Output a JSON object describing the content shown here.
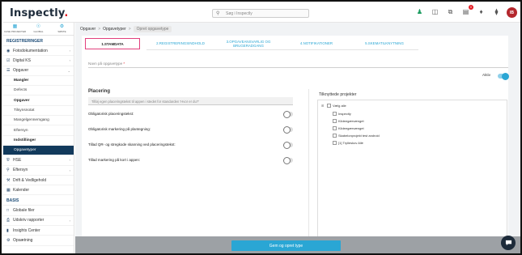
{
  "brand": {
    "logo_text": "Inspectly",
    "logo_dot": ".",
    "accent": "#2aa6d4",
    "dark": "#123a5c",
    "red": "#e31b23"
  },
  "header": {
    "search_placeholder": "Søg i Inspectly",
    "icons": [
      "person-upload-icon",
      "sitemap-icon",
      "copy-icon",
      "notification-cart-icon",
      "bell-icon",
      "pin-icon"
    ],
    "notification_count": "0",
    "avatar_initials": "IB"
  },
  "sidebar": {
    "top_nav": [
      {
        "label": "CASE PROJEKTER",
        "icon": "case-icon"
      },
      {
        "label": "GLOBAL",
        "icon": "globe-icon"
      },
      {
        "label": "SØNTE",
        "icon": "settings-icon"
      }
    ],
    "section_registreringer": "REGISTRERINGER",
    "items_a": [
      {
        "label": "Fotodokumentation",
        "icon": "camera-icon",
        "has_chevron": true
      },
      {
        "label": "Digital KS",
        "icon": "checklist-icon",
        "has_chevron": true
      },
      {
        "label": "Opgaver",
        "icon": "task-icon",
        "has_chevron": true
      }
    ],
    "opgaver_sub": [
      {
        "label": "Mangler",
        "style": "bold"
      },
      {
        "label": "Defects",
        "style": ""
      },
      {
        "label": "Opgaver",
        "style": "bold"
      },
      {
        "label": "Tilsynsnotat",
        "style": ""
      },
      {
        "label": "Mangelgennemgang",
        "style": ""
      },
      {
        "label": "Eftersyn",
        "style": ""
      },
      {
        "label": "Indstillinger",
        "style": "bold"
      },
      {
        "label": "Opgavetyper",
        "style": "active"
      }
    ],
    "items_b": [
      {
        "label": "HSE",
        "icon": "shield-icon",
        "has_chevron": true
      },
      {
        "label": "Eftersyn",
        "icon": "search-icon",
        "has_chevron": true
      },
      {
        "label": "Drift & Vedligehold",
        "icon": "wrench-icon",
        "has_chevron": false
      },
      {
        "label": "Kalender",
        "icon": "calendar-icon",
        "has_chevron": false
      }
    ],
    "section_basis": "BASIS",
    "items_c": [
      {
        "label": "Globale filer",
        "icon": "file-icon",
        "has_chevron": false
      },
      {
        "label": "Udskriv rapporter",
        "icon": "print-icon",
        "has_chevron": true
      },
      {
        "label": "Insights Center",
        "icon": "chart-icon",
        "has_chevron": false
      },
      {
        "label": "Opsætning",
        "icon": "gear-icon",
        "has_chevron": false
      }
    ]
  },
  "breadcrumb": {
    "items": [
      "Opgaver",
      "Opgavetyper"
    ],
    "current": "Opret opgavetype",
    "separator": ">"
  },
  "tabs": [
    "1.STAMDATA",
    "2.REGISTRERINGSINDHOLD",
    "3.OPGAVEANSVARLIG OG BRUGERADGANG",
    "4.NOTIFIKATIONER",
    "5.SKEMATILKNYTNING"
  ],
  "form": {
    "name_label": "Navn på opgavetype",
    "required_mark": "*",
    "aktiv_label": "Aktiv",
    "aktiv_on": true,
    "placering_title": "Placering",
    "placering_placeholder": "Tilføj egen placeringstekst til appen i stedet for standarden 'Hvor er du?'",
    "toggles": [
      {
        "label": "Obligatorisk placeringstekst:",
        "on": false
      },
      {
        "label": "Obligatorisk markering på plantegning:",
        "on": false
      },
      {
        "label": "Tillad QR- og stregkode skanning ved placeringstekst:",
        "on": false
      },
      {
        "label": "Tillad markering på kort i appen:",
        "on": false
      }
    ],
    "projects_title": "Tilknyttede projekter",
    "tree": {
      "root_label": "Vælg alle",
      "children": [
        "Inspectly",
        "Kildeegærvænget",
        "Kildeegærvænget",
        "Skabelonprojekt test android",
        "[1] Trylleskov Allé"
      ]
    }
  },
  "footer": {
    "save_label": "Gem og opret type"
  },
  "chat_icon": "chat-icon"
}
